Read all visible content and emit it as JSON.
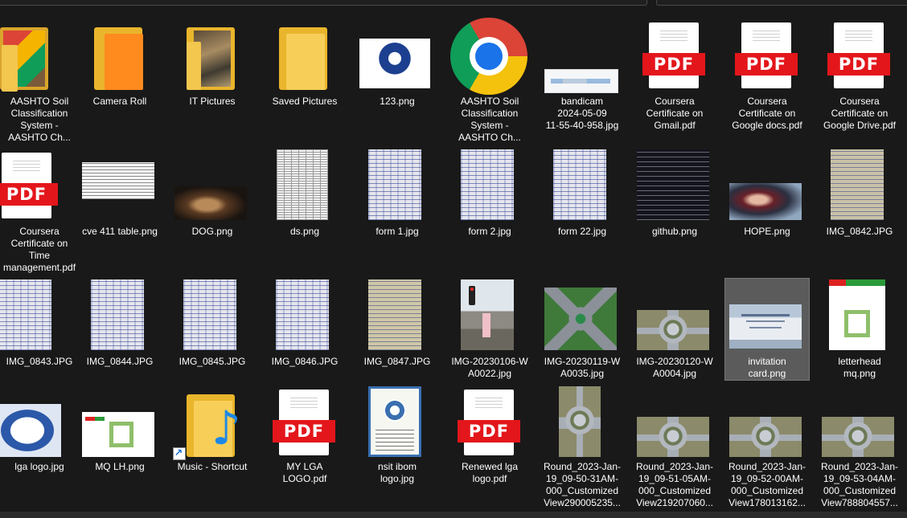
{
  "items": [
    {
      "label": "AASHTO Soil\nClassification\nSystem -\nAASHTO Ch...",
      "icon": "chrome-html-file-icon"
    },
    {
      "label": "Camera Roll",
      "icon": "orange-folder-icon"
    },
    {
      "label": "IT Pictures",
      "icon": "photo-folder-icon"
    },
    {
      "label": "Saved Pictures",
      "icon": "folder-icon"
    },
    {
      "label": "123.png",
      "icon": "image-thumbnail"
    },
    {
      "label": "AASHTO Soil\nClassification\nSystem -\nAASHTO Ch...",
      "icon": "chrome-icon"
    },
    {
      "label": "bandicam\n2024-05-09\n11-55-40-958.jpg",
      "icon": "screenshot-thumbnail"
    },
    {
      "label": "Coursera\nCertificate on\nGmail.pdf",
      "icon": "pdf-icon"
    },
    {
      "label": "Coursera\nCertificate on\nGoogle docs.pdf",
      "icon": "pdf-icon"
    },
    {
      "label": "Coursera\nCertificate on\nGoogle Drive.pdf",
      "icon": "pdf-icon"
    },
    {
      "label": "Coursera\nCertificate on\nTime\nmanagement.pdf",
      "icon": "pdf-icon"
    },
    {
      "label": "cve 411 table.png",
      "icon": "table-thumbnail"
    },
    {
      "label": "DOG.png",
      "icon": "photo-thumbnail"
    },
    {
      "label": "ds.png",
      "icon": "spreadsheet-thumbnail"
    },
    {
      "label": "form 1.jpg",
      "icon": "handwritten-page-thumbnail"
    },
    {
      "label": "form 2.jpg",
      "icon": "handwritten-page-thumbnail"
    },
    {
      "label": "form 22.jpg",
      "icon": "handwritten-page-thumbnail"
    },
    {
      "label": "github.png",
      "icon": "dark-screenshot-thumbnail"
    },
    {
      "label": "HOPE.png",
      "icon": "photo-thumbnail"
    },
    {
      "label": "IMG_0842.JPG",
      "icon": "handwritten-page-thumbnail"
    },
    {
      "label": "IMG_0843.JPG",
      "icon": "handwritten-page-thumbnail"
    },
    {
      "label": "IMG_0844.JPG",
      "icon": "handwritten-page-thumbnail"
    },
    {
      "label": "IMG_0845.JPG",
      "icon": "handwritten-page-thumbnail"
    },
    {
      "label": "IMG_0846.JPG",
      "icon": "handwritten-page-thumbnail"
    },
    {
      "label": "IMG_0847.JPG",
      "icon": "handwritten-page-thumbnail"
    },
    {
      "label": "IMG-20230106-W\nA0022.jpg",
      "icon": "street-photo-thumbnail"
    },
    {
      "label": "IMG-20230119-W\nA0035.jpg",
      "icon": "roundabout-thumbnail"
    },
    {
      "label": "IMG-20230120-W\nA0004.jpg",
      "icon": "roundabout-thumbnail"
    },
    {
      "label": "invitation\ncard.png",
      "icon": "card-thumbnail",
      "selected": true
    },
    {
      "label": "letterhead\nmq.png",
      "icon": "letterhead-thumbnail"
    },
    {
      "label": "lga logo.jpg",
      "icon": "logo-thumbnail"
    },
    {
      "label": "MQ LH.png",
      "icon": "letterhead-thumbnail"
    },
    {
      "label": "Music - Shortcut",
      "icon": "music-folder-shortcut-icon"
    },
    {
      "label": "MY LGA\nLOGO.pdf",
      "icon": "pdf-icon"
    },
    {
      "label": "nsit ibom\nlogo.jpg",
      "icon": "certificate-thumbnail"
    },
    {
      "label": "Renewed lga\nlogo.pdf",
      "icon": "pdf-icon"
    },
    {
      "label": "Round_2023-Jan-\n19_09-50-31AM-\n000_Customized\nView290005235...",
      "icon": "roundabout-thumbnail"
    },
    {
      "label": "Round_2023-Jan-\n19_09-51-05AM-\n000_Customized\nView219207060...",
      "icon": "roundabout-thumbnail"
    },
    {
      "label": "Round_2023-Jan-\n19_09-52-00AM-\n000_Customized\nView178013162...",
      "icon": "roundabout-thumbnail"
    },
    {
      "label": "Round_2023-Jan-\n19_09-53-04AM-\n000_Customized\nView788804557...",
      "icon": "roundabout-thumbnail"
    }
  ],
  "pdf_text": "PDF",
  "colors": {
    "background": "#191919",
    "pdf_red": "#e3161b",
    "folder": "#f7ce58",
    "selection": "#5b5b5b"
  }
}
